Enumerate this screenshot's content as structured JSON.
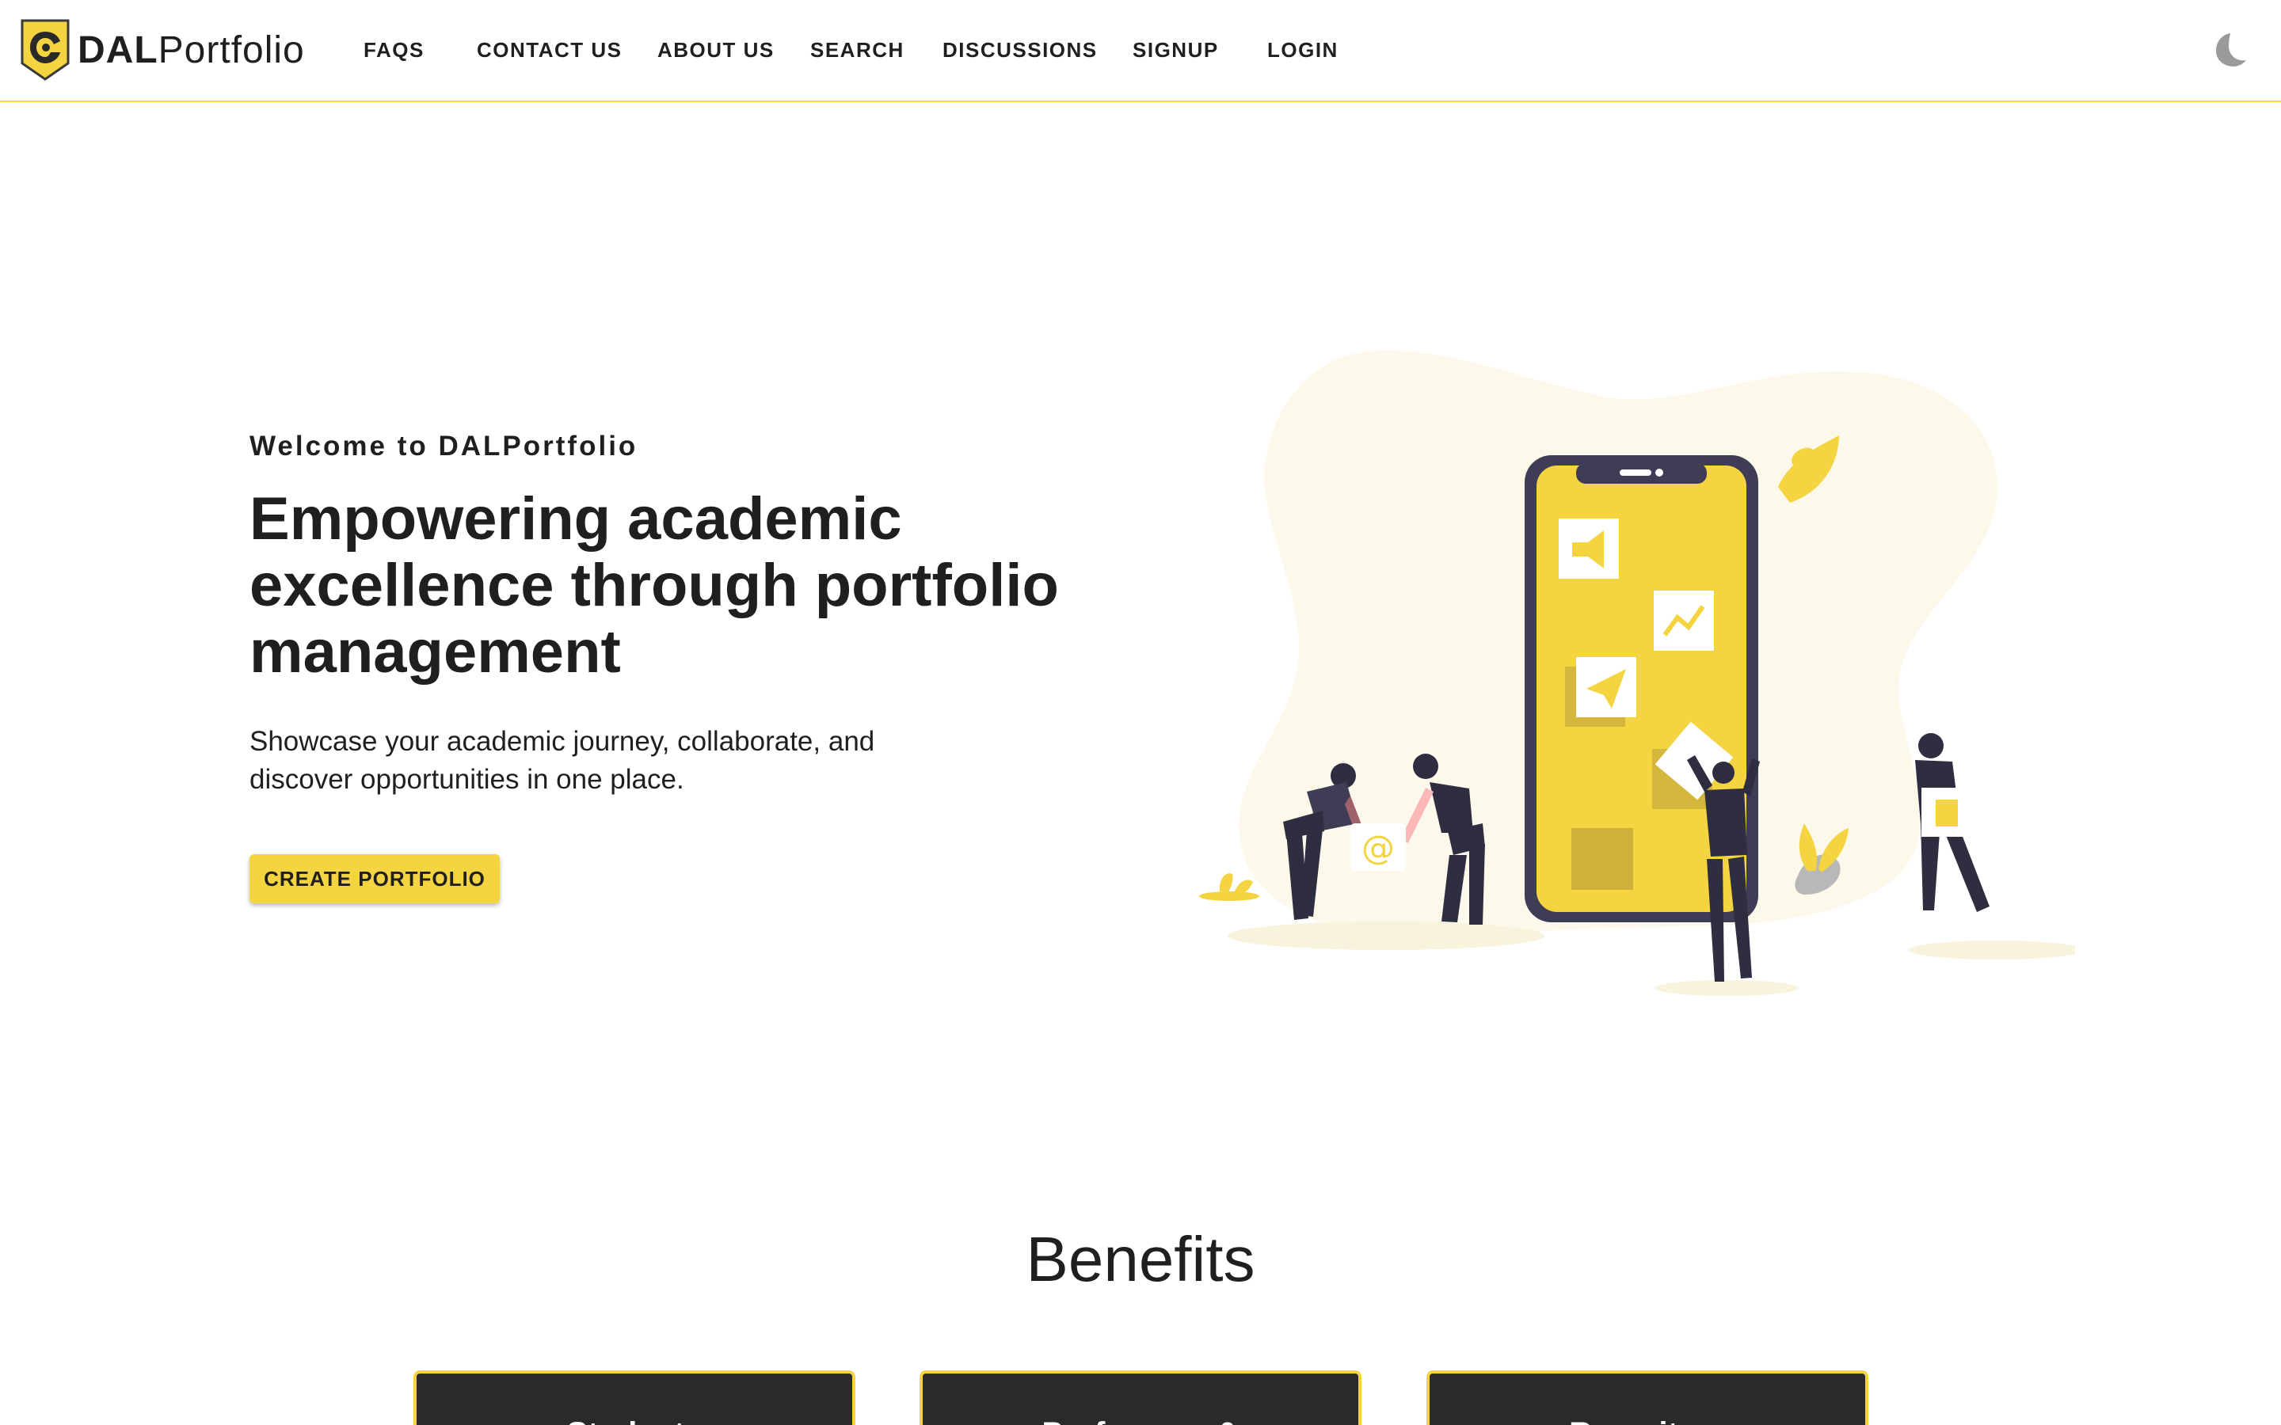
{
  "brand": {
    "name_bold": "DAL",
    "name_light": "Portfolio"
  },
  "nav": {
    "items": [
      {
        "label": "FAQS"
      },
      {
        "label": "CONTACT US"
      },
      {
        "label": "ABOUT US"
      },
      {
        "label": "SEARCH"
      },
      {
        "label": "DISCUSSIONS"
      },
      {
        "label": "SIGNUP"
      },
      {
        "label": "LOGIN"
      }
    ],
    "theme_toggle_icon": "moon-icon"
  },
  "hero": {
    "kicker": "Welcome to DALPortfolio",
    "title": "Empowering academic excellence through portfolio management",
    "subtitle": "Showcase your academic journey, collaborate, and discover opportunities in one place.",
    "cta_label": "CREATE PORTFOLIO"
  },
  "benefits": {
    "title": "Benefits",
    "cards": [
      {
        "label": "Students"
      },
      {
        "label": "Professors &"
      },
      {
        "label": "Recruiters"
      }
    ]
  },
  "colors": {
    "accent": "#f4d440",
    "text": "#1f1f1f",
    "card_bg": "#2a2a2a",
    "illustration_purple": "#3f3d56"
  }
}
